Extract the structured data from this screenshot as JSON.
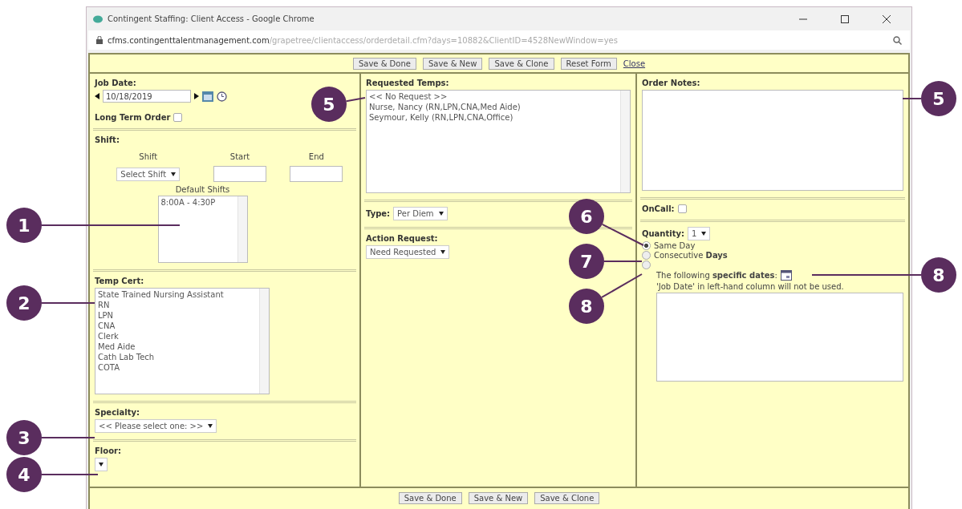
{
  "window": {
    "title": "Contingent Staffing: Client Access - Google Chrome"
  },
  "address_bar": {
    "host": "cfms.contingenttalentmanagement.com",
    "path": "/grapetree/clientaccess/orderdetail.cfm?days=10882&ClientID=4528NewWindow=yes"
  },
  "top_toolbar": {
    "buttons": [
      "Save & Done",
      "Save & New",
      "Save & Clone",
      "Reset Form"
    ],
    "link": "Close"
  },
  "job_date": {
    "label": "Job Date:",
    "value": "10/18/2019"
  },
  "long_term_order": {
    "label": "Long Term Order",
    "checked": false
  },
  "shift": {
    "label": "Shift:",
    "columns": [
      "Shift",
      "Start",
      "End"
    ],
    "select": "Select Shift",
    "default_shifts": {
      "label": "Default Shifts",
      "items": [
        "8:00A - 4:30P"
      ]
    }
  },
  "temp_cert": {
    "label": "Temp Cert:",
    "items": [
      "State Trained Nursing Assistant",
      "RN",
      "LPN",
      "CNA",
      "Clerk",
      "Med Aide",
      "Cath Lab Tech",
      "COTA"
    ]
  },
  "specialty": {
    "label": "Specialty:",
    "value": "<< Please select one: >>"
  },
  "floor": {
    "label": "Floor:"
  },
  "requested_temps": {
    "label": "Requested Temps:",
    "items": [
      "<< No Request >>",
      "Nurse, Nancy (RN,LPN,CNA,Med Aide)",
      "Seymour, Kelly (RN,LPN,CNA,Office)"
    ]
  },
  "type": {
    "label": "Type:",
    "value": "Per Diem"
  },
  "action_request": {
    "label": "Action Request:",
    "value": "Need Requested"
  },
  "order_notes": {
    "label": "Order Notes:"
  },
  "oncall": {
    "label": "OnCall:",
    "checked": false
  },
  "quantity": {
    "label": "Quantity:",
    "value": "1"
  },
  "date_options": [
    {
      "kind": "plain",
      "text": "Same Day",
      "selected": true
    },
    {
      "kind": "plain",
      "text": "Consecutive **Days**",
      "selected": false
    },
    {
      "kind": "dates",
      "text": "The following **specific dates**:",
      "note": "'Job Date' in left-hand column will not be used.",
      "selected": false
    }
  ],
  "bottom_toolbar": {
    "buttons": [
      "Save & Done",
      "Save & New",
      "Save & Clone"
    ]
  },
  "callouts": [
    {
      "label": "1"
    },
    {
      "label": "2"
    },
    {
      "label": "3"
    },
    {
      "label": "4"
    },
    {
      "label": "5"
    },
    {
      "label": "5"
    },
    {
      "label": "6"
    },
    {
      "label": "7"
    },
    {
      "label": "8"
    },
    {
      "label": "8"
    }
  ]
}
